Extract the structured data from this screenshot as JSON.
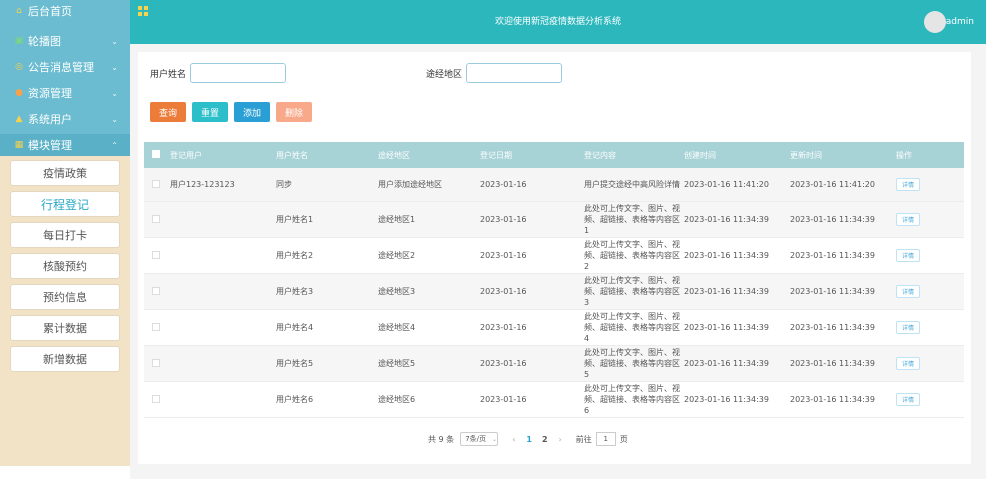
{
  "sidebar": {
    "items": [
      {
        "icon": "home-icon",
        "label": "后台首页"
      },
      {
        "icon": "image-icon",
        "label": "轮播图"
      },
      {
        "icon": "info-icon",
        "label": "公告消息管理"
      },
      {
        "icon": "resource-icon",
        "label": "资源管理"
      },
      {
        "icon": "user-icon",
        "label": "系统用户"
      },
      {
        "icon": "module-icon",
        "label": "模块管理"
      }
    ],
    "sub_items": [
      {
        "label": "疫情政策"
      },
      {
        "label": "行程登记"
      },
      {
        "label": "每日打卡"
      },
      {
        "label": "核酸预约"
      },
      {
        "label": "预约信息"
      },
      {
        "label": "累计数据"
      },
      {
        "label": "新增数据"
      }
    ]
  },
  "topbar": {
    "title": "欢迎使用新冠疫情数据分析系统",
    "user": "admin"
  },
  "search": {
    "name_label": "用户姓名",
    "name_value": "",
    "region_label": "途经地区",
    "region_value": ""
  },
  "buttons": {
    "query": "查询",
    "reset": "重置",
    "add": "添加",
    "delete": "删除"
  },
  "table": {
    "headers": [
      "登记用户",
      "用户姓名",
      "途经地区",
      "登记日期",
      "登记内容",
      "创建时间",
      "更新时间",
      "操作"
    ],
    "rows": [
      {
        "user": "用户123-123123",
        "name": "同步",
        "region": "用户添加途经地区",
        "date": "2023-01-16",
        "content": "用户提交途经中高风险详情",
        "created": "2023-01-16 11:41:20",
        "updated": "2023-01-16 11:41:20",
        "op": "详情"
      },
      {
        "user": "",
        "name": "用户姓名1",
        "region": "途经地区1",
        "date": "2023-01-16",
        "content": "此处可上传文字、图片、视频、超链接、表格等内容区1",
        "created": "2023-01-16 11:34:39",
        "updated": "2023-01-16 11:34:39",
        "op": "详情"
      },
      {
        "user": "",
        "name": "用户姓名2",
        "region": "途经地区2",
        "date": "2023-01-16",
        "content": "此处可上传文字、图片、视频、超链接、表格等内容区2",
        "created": "2023-01-16 11:34:39",
        "updated": "2023-01-16 11:34:39",
        "op": "详情"
      },
      {
        "user": "",
        "name": "用户姓名3",
        "region": "途经地区3",
        "date": "2023-01-16",
        "content": "此处可上传文字、图片、视频、超链接、表格等内容区3",
        "created": "2023-01-16 11:34:39",
        "updated": "2023-01-16 11:34:39",
        "op": "详情"
      },
      {
        "user": "",
        "name": "用户姓名4",
        "region": "途经地区4",
        "date": "2023-01-16",
        "content": "此处可上传文字、图片、视频、超链接、表格等内容区4",
        "created": "2023-01-16 11:34:39",
        "updated": "2023-01-16 11:34:39",
        "op": "详情"
      },
      {
        "user": "",
        "name": "用户姓名5",
        "region": "途经地区5",
        "date": "2023-01-16",
        "content": "此处可上传文字、图片、视频、超链接、表格等内容区5",
        "created": "2023-01-16 11:34:39",
        "updated": "2023-01-16 11:34:39",
        "op": "详情"
      },
      {
        "user": "",
        "name": "用户姓名6",
        "region": "途经地区6",
        "date": "2023-01-16",
        "content": "此处可上传文字、图片、视频、超链接、表格等内容区6",
        "created": "2023-01-16 11:34:39",
        "updated": "2023-01-16 11:34:39",
        "op": "详情"
      }
    ]
  },
  "pagination": {
    "total": "共 9 条",
    "page_size": "7条/页",
    "pages": [
      "1",
      "2"
    ],
    "current_page": "1",
    "goto_label": "前往",
    "goto_value": "1",
    "page_suffix": "页"
  },
  "colors": {
    "topbar": "#2cb7bd",
    "sidebar_menu": "#6bbcd0",
    "sidebar_bg": "#f3e3c6",
    "table_header": "#a7d2d6"
  }
}
